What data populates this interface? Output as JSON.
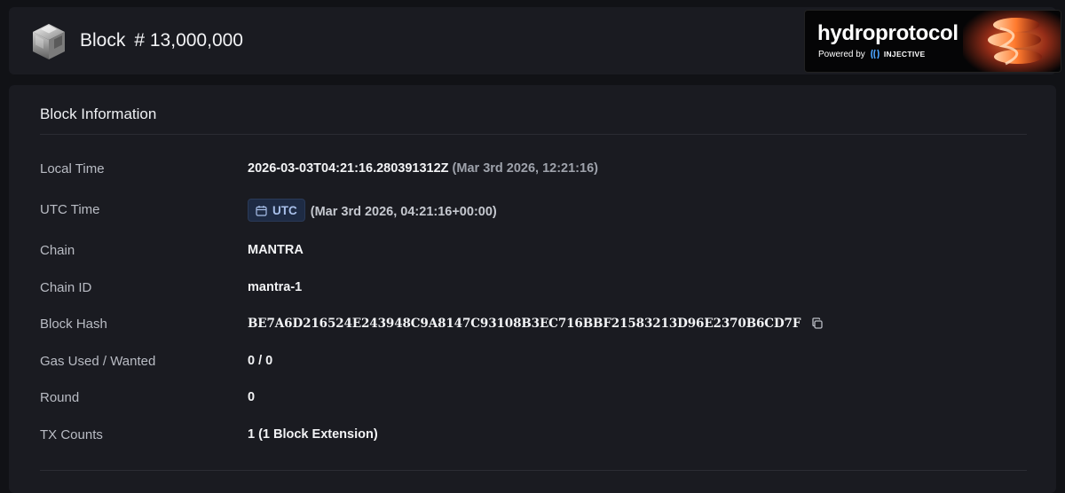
{
  "header": {
    "block_label": "Block",
    "block_number": "# 13,000,000"
  },
  "banner": {
    "brand": "hydroprotocol",
    "powered_by": "Powered by",
    "partner": "INJECTIVE"
  },
  "panel": {
    "title": "Block Information",
    "rows": [
      {
        "label": "Local Time",
        "value": "2026-03-03T04:21:16.280391312Z",
        "extra": "(Mar 3rd 2026, 12:21:16)"
      },
      {
        "label": "UTC Time",
        "badge": "UTC",
        "value": "(Mar 3rd 2026, 04:21:16+00:00)"
      },
      {
        "label": "Chain",
        "value": "MANTRA"
      },
      {
        "label": "Chain ID",
        "value": "mantra-1"
      },
      {
        "label": "Block Hash",
        "value": "BE7A6D216524E243948C9A8147C93108B3EC716BBF21583213D96E2370B6CD7F"
      },
      {
        "label": "Gas Used / Wanted",
        "value": "0 / 0"
      },
      {
        "label": "Round",
        "value": "0"
      },
      {
        "label": "TX Counts",
        "value": "1 (1 Block Extension)"
      }
    ]
  },
  "icons": {
    "logo": "cube-logo-icon",
    "calendar": "calendar-icon",
    "copy": "copy-icon",
    "injective": "injective-icon"
  },
  "colors": {
    "background": "#111216",
    "panel": "#1a1b21",
    "badge_bg": "#1e2b44",
    "badge_text": "#a9c0ea"
  }
}
